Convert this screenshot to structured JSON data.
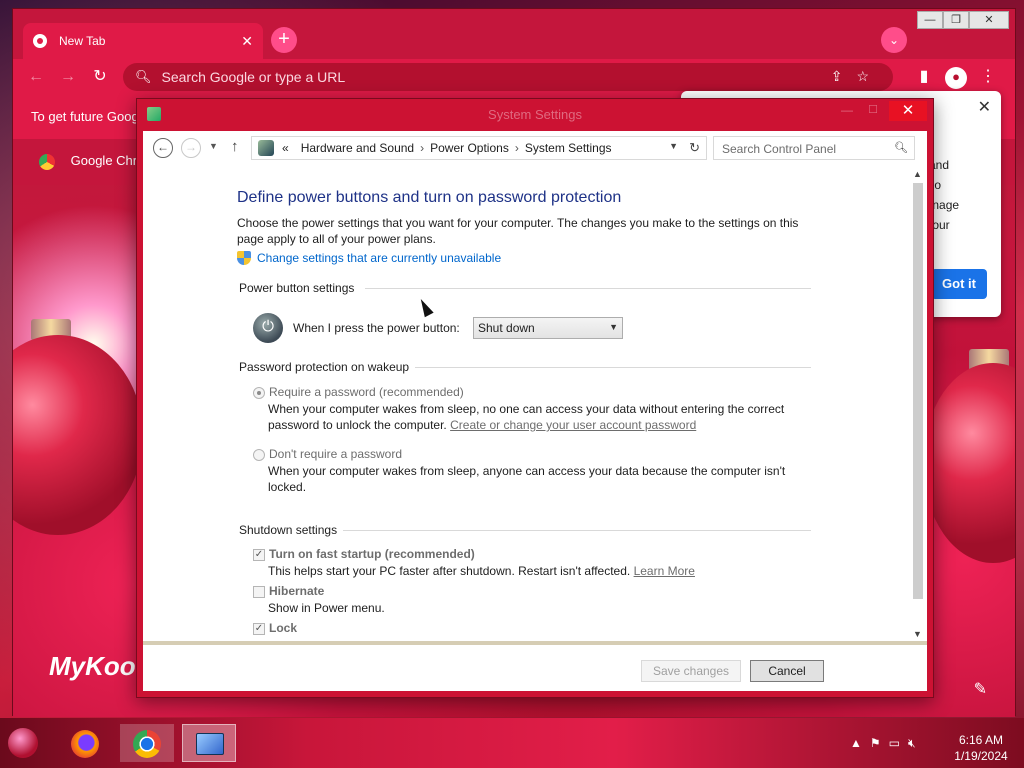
{
  "chrome": {
    "tab_title": "New Tab",
    "omnibox_placeholder": "Search Google or type a URL",
    "infobar_text": "To get future Goog",
    "bookmark_label": "Google Chro",
    "popup_lines": [
      "g and",
      "also",
      "nanage",
      "r your"
    ],
    "got_it_label": "Got it",
    "ntp_logo": "MyKool",
    "accent_color": "#e01a47"
  },
  "dialog": {
    "title": "System Settings",
    "breadcrumb": {
      "prefix": "«",
      "items": [
        "Hardware and Sound",
        "Power Options",
        "System Settings"
      ]
    },
    "search_placeholder": "Search Control Panel",
    "heading": "Define power buttons and turn on password protection",
    "intro": "Choose the power settings that you want for your computer. The changes you make to the settings on this page apply to all of your power plans.",
    "change_settings_link": "Change settings that are currently unavailable",
    "power_section": {
      "title": "Power button settings",
      "label": "When I press the power button:",
      "selected": "Shut down"
    },
    "password_section": {
      "title": "Password protection on wakeup",
      "require_label": "Require a password (recommended)",
      "require_desc": "When your computer wakes from sleep, no one can access your data without entering the correct password to unlock the computer.",
      "require_link": "Create or change your user account password",
      "norequire_label": "Don't require a password",
      "norequire_desc": "When your computer wakes from sleep, anyone can access your data because the computer isn't locked."
    },
    "shutdown_section": {
      "title": "Shutdown settings",
      "fast_startup_label": "Turn on fast startup (recommended)",
      "fast_startup_desc": "This helps start your PC faster after shutdown. Restart isn't affected.",
      "learn_more": "Learn More",
      "hibernate_label": "Hibernate",
      "hibernate_desc": "Show in Power menu.",
      "lock_label": "Lock"
    },
    "save_label": "Save changes",
    "cancel_label": "Cancel"
  },
  "taskbar": {
    "time": "6:16 AM",
    "date": "1/19/2024"
  }
}
